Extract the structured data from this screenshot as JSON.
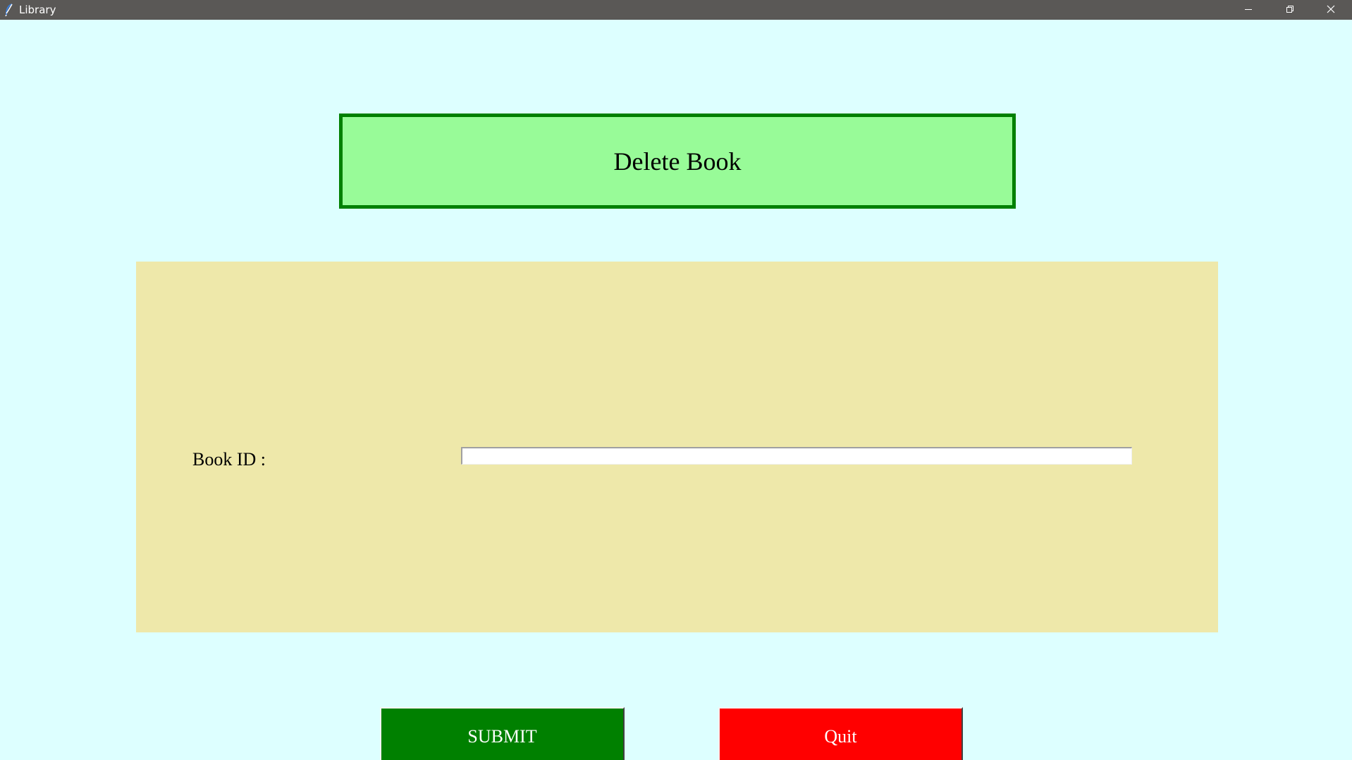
{
  "window": {
    "title": "Library",
    "app_icon": "feather-icon",
    "controls": {
      "minimize_icon": "minimize-icon",
      "restore_icon": "restore-icon",
      "close_icon": "close-icon"
    }
  },
  "heading": {
    "text": "Delete Book"
  },
  "form": {
    "book_id_label": "Book ID :",
    "book_id_value": "",
    "book_id_placeholder": ""
  },
  "buttons": {
    "submit_label": "SUBMIT",
    "quit_label": "Quit"
  },
  "colors": {
    "window_background": "#ddffff",
    "heading_background": "#98fb98",
    "heading_border": "#008000",
    "form_background": "#eee8aa",
    "submit_background": "#008000",
    "quit_background": "#ff0000",
    "titlebar": "#5a5856"
  }
}
